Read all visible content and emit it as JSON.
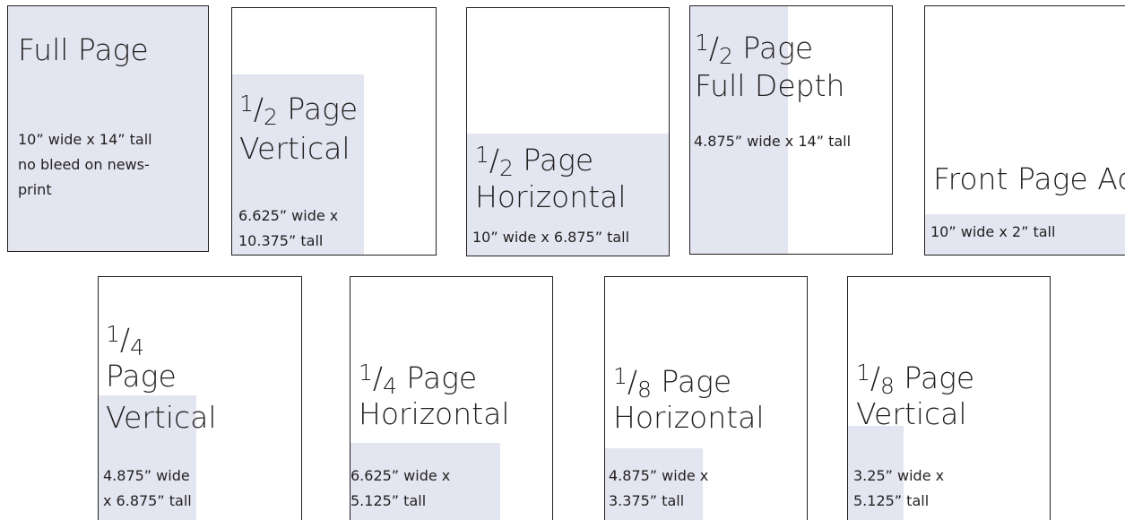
{
  "ads": {
    "full_page": {
      "title": "Full Page",
      "dim1": "10” wide x 14” tall",
      "dim2": "no bleed on news-",
      "dim3": "print"
    },
    "half_vertical": {
      "num": "1",
      "den": "2",
      "title_rest": " Page",
      "title2": "Vertical",
      "dim1": "6.625” wide x",
      "dim2": "10.375” tall"
    },
    "half_horizontal": {
      "num": "1",
      "den": "2",
      "title_rest": " Page",
      "title2": "Horizontal",
      "dim1": "10” wide x 6.875” tall"
    },
    "half_full_depth": {
      "num": "1",
      "den": "2",
      "title_rest": " Page",
      "title2": "Full Depth",
      "dim1": "4.875” wide x 14” tall"
    },
    "front_page_ad": {
      "title": "Front Page Ad",
      "dim1": "10” wide x 2” tall"
    },
    "quarter_vertical": {
      "num": "1",
      "den": "4",
      "title2": "Page",
      "title3": "Vertical",
      "dim1": "4.875” wide",
      "dim2": "x 6.875” tall"
    },
    "quarter_horizontal": {
      "num": "1",
      "den": "4",
      "title_rest": " Page",
      "title2": "Horizontal",
      "dim1": "6.625” wide x",
      "dim2": "5.125” tall"
    },
    "eighth_horizontal": {
      "num": "1",
      "den": "8",
      "title_rest": " Page",
      "title2": "Horizontal",
      "dim1": "4.875” wide x",
      "dim2": "3.375” tall"
    },
    "eighth_vertical": {
      "num": "1",
      "den": "8",
      "title_rest": " Page",
      "title2": "Vertical",
      "dim1": "3.25” wide x",
      "dim2": "5.125” tall"
    }
  },
  "colors": {
    "ad_fill": "#e3e5f0",
    "border": "#231f20",
    "text": "#231f20"
  }
}
